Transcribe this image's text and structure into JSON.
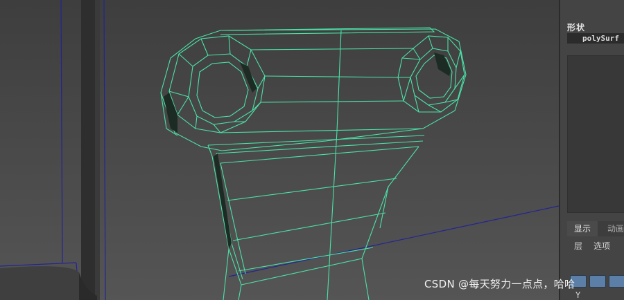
{
  "colors": {
    "viewport_bg": "#4a4a4a",
    "wireframe": "#4be3a8",
    "grid_line": "#232396",
    "panel_bg": "#444444",
    "field_bg": "#2b2b2b",
    "tool_button": "#5b7fa6"
  },
  "panel": {
    "title": "形状",
    "shape_name": "polySurf",
    "tabs": [
      {
        "label": "显示"
      },
      {
        "label": "动画"
      }
    ],
    "menu": [
      "层",
      "选项"
    ],
    "axis_label": "Y"
  },
  "watermark": "CSDN @每天努力一点点，哈哈"
}
